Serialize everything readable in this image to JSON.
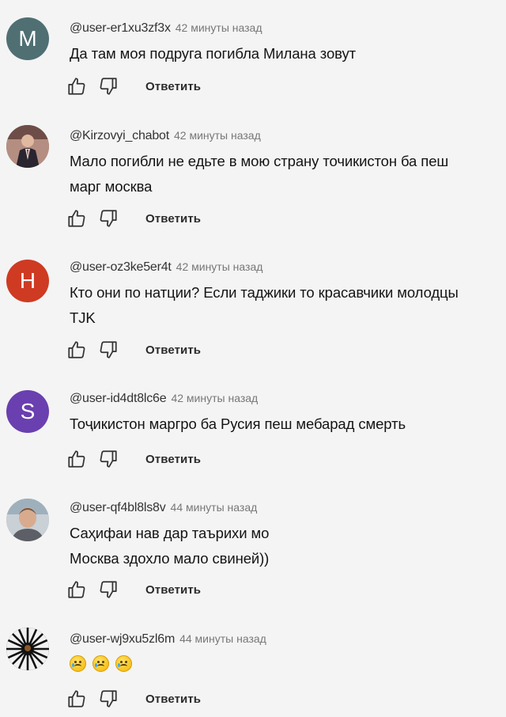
{
  "comments": [
    {
      "author": "@user-er1xu3zf3x",
      "time": "42 минуты назад",
      "text": "Да там моя подруга погибла Милана зовут",
      "avatar_letter": "M",
      "avatar_color": "#4f6f73",
      "reply_label": "Ответить"
    },
    {
      "author": "@Kirzovyi_chabot",
      "time": "42 минуты назад",
      "text": "Мало погибли не едьте в мою страну точикистон ба пеш марг москва",
      "avatar_letter": "",
      "avatar_color": "#8a6b63",
      "reply_label": "Ответить"
    },
    {
      "author": "@user-oz3ke5er4t",
      "time": "42 минуты назад",
      "text": "Кто они по натции? Если таджики то красавчики молодцы TJK",
      "avatar_letter": "H",
      "avatar_color": "#cf3a22",
      "reply_label": "Ответить"
    },
    {
      "author": "@user-id4dt8lc6e",
      "time": "42 минуты назад",
      "text": "Тоҷикистон маргро ба Русия пеш мебарад смерть",
      "avatar_letter": "S",
      "avatar_color": "#6a3fb0",
      "reply_label": "Ответить"
    },
    {
      "author": "@user-qf4bl8ls8v",
      "time": "44 минуты назад",
      "text": "Саҳифаи нав дар таърихи мо\nМосква здохло мало свиней))",
      "avatar_letter": "",
      "avatar_color": "#b7a896",
      "reply_label": "Ответить"
    },
    {
      "author": "@user-wj9xu5zl6m",
      "time": "44 минуты назад",
      "text": "",
      "emoji": [
        "crying-face",
        "crying-face",
        "crying-face"
      ],
      "avatar_letter": "",
      "avatar_color": "#111111",
      "reply_label": "Ответить"
    }
  ],
  "icons": {
    "like": "thumb-up-icon",
    "dislike": "thumb-down-icon"
  }
}
